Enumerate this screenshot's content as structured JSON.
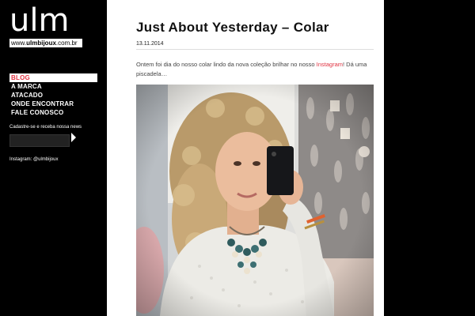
{
  "logo": {
    "word": "ulm",
    "url_prefix": "www.",
    "url_brand": "ulmbijoux",
    "url_suffix": ".com.br"
  },
  "nav": [
    {
      "label": "BLOG",
      "active": true
    },
    {
      "label": "A MARCA",
      "active": false
    },
    {
      "label": "ATACADO",
      "active": false
    },
    {
      "label": "ONDE ENCONTRAR",
      "active": false
    },
    {
      "label": "FALE CONOSCO",
      "active": false
    }
  ],
  "newsletter": {
    "label": "Cadastre-se e receba nossa news",
    "value": ""
  },
  "instagram": {
    "handle": "Instagram: @ulmbijoux"
  },
  "post": {
    "title": "Just About Yesterday – Colar",
    "date": "13.11.2014",
    "body_prefix": "Ontem foi dia do nosso colar lindo da nova coleção brilhar no nosso ",
    "body_link": "Instagram",
    "body_suffix": "! Dá uma piscadela…"
  },
  "colors": {
    "accent": "#e03342",
    "sidebar_bg": "#000000",
    "content_bg": "#ffffff"
  }
}
